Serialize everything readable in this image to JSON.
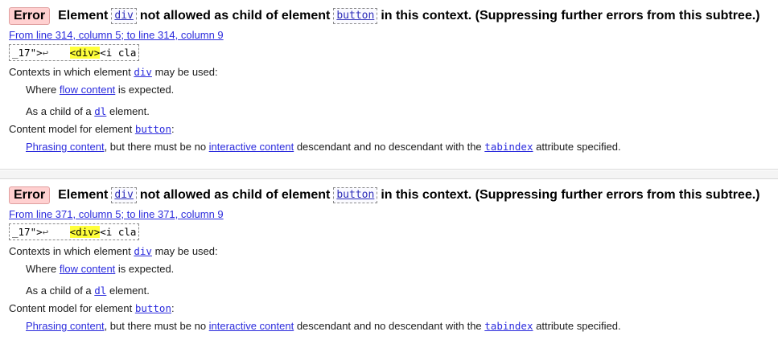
{
  "messages": [
    {
      "badge": "Error",
      "head_1": "Element",
      "head_elem": "div",
      "head_2": "not allowed as child of element",
      "head_parent": "button",
      "head_3": "in this context. (Suppressing further errors from this subtree.)",
      "location": "From line 314, column 5; to line 314, column 9",
      "extract_pre": "_17\">",
      "extract_lf": "↩",
      "extract_hl": "<div>",
      "extract_post": "<i cla",
      "contexts_prefix": "Contexts in which element",
      "contexts_elem": "div",
      "contexts_suffix": "may be used:",
      "where_prefix": "Where",
      "where_link": "flow content",
      "where_suffix": "is expected.",
      "child_prefix": "As a child of a",
      "child_link": "dl",
      "child_suffix": "element.",
      "model_prefix": "Content model for element",
      "model_elem": "button",
      "model_suffix": ":",
      "phr_link1": "Phrasing content",
      "phr_text1": ", but there must be no",
      "phr_link2": "interactive content",
      "phr_text2": "descendant and no descendant with the",
      "phr_link3": "tabindex",
      "phr_text3": "attribute specified."
    },
    {
      "badge": "Error",
      "head_1": "Element",
      "head_elem": "div",
      "head_2": "not allowed as child of element",
      "head_parent": "button",
      "head_3": "in this context. (Suppressing further errors from this subtree.)",
      "location": "From line 371, column 5; to line 371, column 9",
      "extract_pre": "_17\">",
      "extract_lf": "↩",
      "extract_hl": "<div>",
      "extract_post": "<i cla",
      "contexts_prefix": "Contexts in which element",
      "contexts_elem": "div",
      "contexts_suffix": "may be used:",
      "where_prefix": "Where",
      "where_link": "flow content",
      "where_suffix": "is expected.",
      "child_prefix": "As a child of a",
      "child_link": "dl",
      "child_suffix": "element.",
      "model_prefix": "Content model for element",
      "model_elem": "button",
      "model_suffix": ":",
      "phr_link1": "Phrasing content",
      "phr_text1": ", but there must be no",
      "phr_link2": "interactive content",
      "phr_text2": "descendant and no descendant with the",
      "phr_link3": "tabindex",
      "phr_text3": "attribute specified."
    }
  ],
  "colors": {
    "badge_bg": "#ffd0d0",
    "link": "#2b2bdd",
    "highlight": "#ffff3a"
  }
}
